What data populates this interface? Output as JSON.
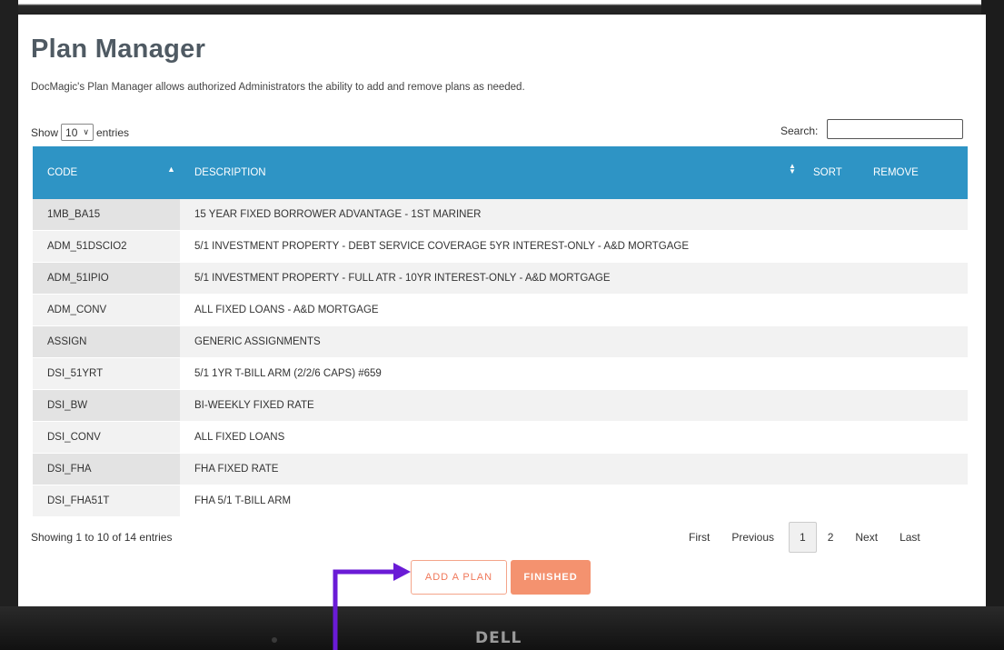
{
  "page": {
    "title": "Plan Manager",
    "subtitle": "DocMagic's Plan Manager allows authorized Administrators the ability to add and remove plans as needed."
  },
  "length_control": {
    "show_label": "Show",
    "selected": "10",
    "entries_label": "entries"
  },
  "search": {
    "label": "Search:",
    "value": ""
  },
  "table": {
    "headers": {
      "code": "CODE",
      "description": "DESCRIPTION",
      "sort": "SORT",
      "remove": "REMOVE"
    },
    "rows": [
      {
        "code": "1MB_BA15",
        "description": "15 YEAR FIXED BORROWER ADVANTAGE - 1ST MARINER"
      },
      {
        "code": "ADM_51DSCIO2",
        "description": "5/1 INVESTMENT PROPERTY - DEBT SERVICE COVERAGE 5YR INTEREST-ONLY - A&D MORTGAGE"
      },
      {
        "code": "ADM_51IPIO",
        "description": "5/1 INVESTMENT PROPERTY - FULL ATR - 10YR INTEREST-ONLY - A&D MORTGAGE"
      },
      {
        "code": "ADM_CONV",
        "description": "ALL FIXED LOANS - A&D MORTGAGE"
      },
      {
        "code": "ASSIGN",
        "description": "GENERIC ASSIGNMENTS"
      },
      {
        "code": "DSI_51YRT",
        "description": "5/1 1YR T-BILL ARM (2/2/6 CAPS) #659"
      },
      {
        "code": "DSI_BW",
        "description": "BI-WEEKLY FIXED RATE"
      },
      {
        "code": "DSI_CONV",
        "description": "ALL FIXED LOANS"
      },
      {
        "code": "DSI_FHA",
        "description": "FHA FIXED RATE"
      },
      {
        "code": "DSI_FHA51T",
        "description": "FHA 5/1 T-BILL ARM"
      }
    ]
  },
  "footer": {
    "info": "Showing 1 to 10 of 14 entries"
  },
  "pagination": {
    "first": "First",
    "previous": "Previous",
    "pages": [
      "1",
      "2"
    ],
    "current": "1",
    "next": "Next",
    "last": "Last"
  },
  "actions": {
    "add": "ADD A PLAN",
    "finished": "FINISHED"
  },
  "device": {
    "logo": "DELL"
  },
  "colors": {
    "header": "#2e94c5",
    "accent": "#f4926f",
    "arrow": "#6a1bd6"
  },
  "icons": {
    "sort_asc": "caret-up-icon",
    "sort_both": "sort-icon",
    "select": "chevron-down-icon",
    "annotation": "arrow-icon"
  }
}
